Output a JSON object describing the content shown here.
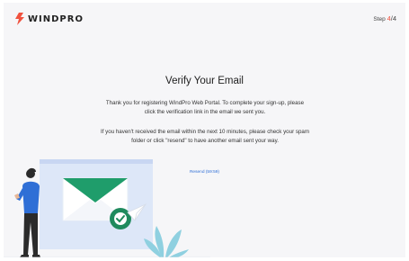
{
  "brand": {
    "name": "WINDPRO",
    "accent_color": "#f0523f"
  },
  "step": {
    "label": "Step",
    "current": "4",
    "separator": "/",
    "total": "4"
  },
  "main": {
    "title": "Verify Your Email",
    "paragraph1": "Thank you for registering WindPro Web Portal. To complete your sign-up, please click the verification link in the email we sent you.",
    "paragraph2": "If you haven't received the email within the next 10 minutes, please check your spam folder or click \"resend\" to have another email sent your way.",
    "resend_label": "Resend (59:59)",
    "link_color": "#2f6fd6"
  },
  "illustration": {
    "envelope_color": "#1f9d6b",
    "plant_color": "#8fd0e0",
    "icons": [
      "envelope-icon",
      "check-circle-icon",
      "paper-plane-icon",
      "person-figure",
      "plant-leaves"
    ]
  }
}
